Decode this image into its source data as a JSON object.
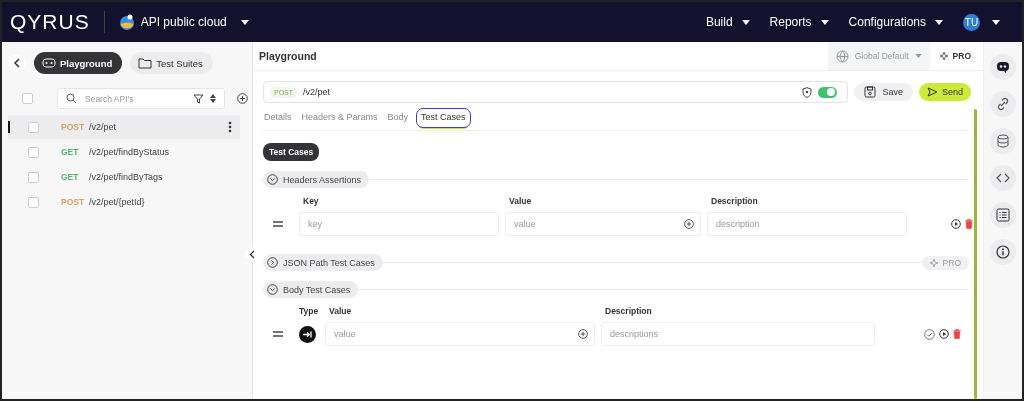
{
  "header": {
    "logo": "QYRUS",
    "project": "API public cloud",
    "menus": [
      {
        "label": "Build"
      },
      {
        "label": "Reports"
      },
      {
        "label": "Configurations"
      }
    ],
    "avatar": "TU"
  },
  "sidebar": {
    "tabs": [
      {
        "label": "Playground",
        "selected": true
      },
      {
        "label": "Test Suites",
        "selected": false
      }
    ],
    "select_all_checked": false,
    "search": {
      "placeholder": "Search API's"
    },
    "items": [
      {
        "method": "POST",
        "path": "/v2/pet",
        "color": "#d9a45e",
        "selected": true,
        "checked": false
      },
      {
        "method": "GET",
        "path": "/v2/pet/findByStatus",
        "color": "#52b56c",
        "selected": false,
        "checked": false
      },
      {
        "method": "GET",
        "path": "/v2/pet/findByTags",
        "color": "#52b56c",
        "selected": false,
        "checked": false
      },
      {
        "method": "POST",
        "path": "/v2/pet/{petId}",
        "color": "#d9a45e",
        "selected": false,
        "checked": false
      }
    ]
  },
  "main": {
    "title": "Playground",
    "environment": "Global Default",
    "pro": "PRO",
    "request": {
      "method": "POST",
      "url": "/v2/pet",
      "toggle_on": true
    },
    "save": "Save",
    "send": "Send",
    "tabs": [
      {
        "label": "Details",
        "selected": false
      },
      {
        "label": "Headers & Params",
        "selected": false
      },
      {
        "label": "Body",
        "selected": false
      },
      {
        "label": "Test Cases",
        "selected": true
      }
    ],
    "section_label": "Test Cases",
    "headers_assertions": {
      "title": "Headers Assertions",
      "expanded": true,
      "columns": [
        "Key",
        "Value",
        "Description"
      ],
      "key_placeholder": "key",
      "value_placeholder": "value",
      "description_placeholder": "description"
    },
    "json_path": {
      "title": "JSON Path Test Cases",
      "expanded": false,
      "badge": "PRO"
    },
    "body_tests": {
      "title": "Body Test Cases",
      "expanded": true,
      "type_column": "Type",
      "columns": [
        "Value",
        "Description"
      ],
      "value_placeholder": "value",
      "description_placeholder": "descriptions"
    }
  }
}
